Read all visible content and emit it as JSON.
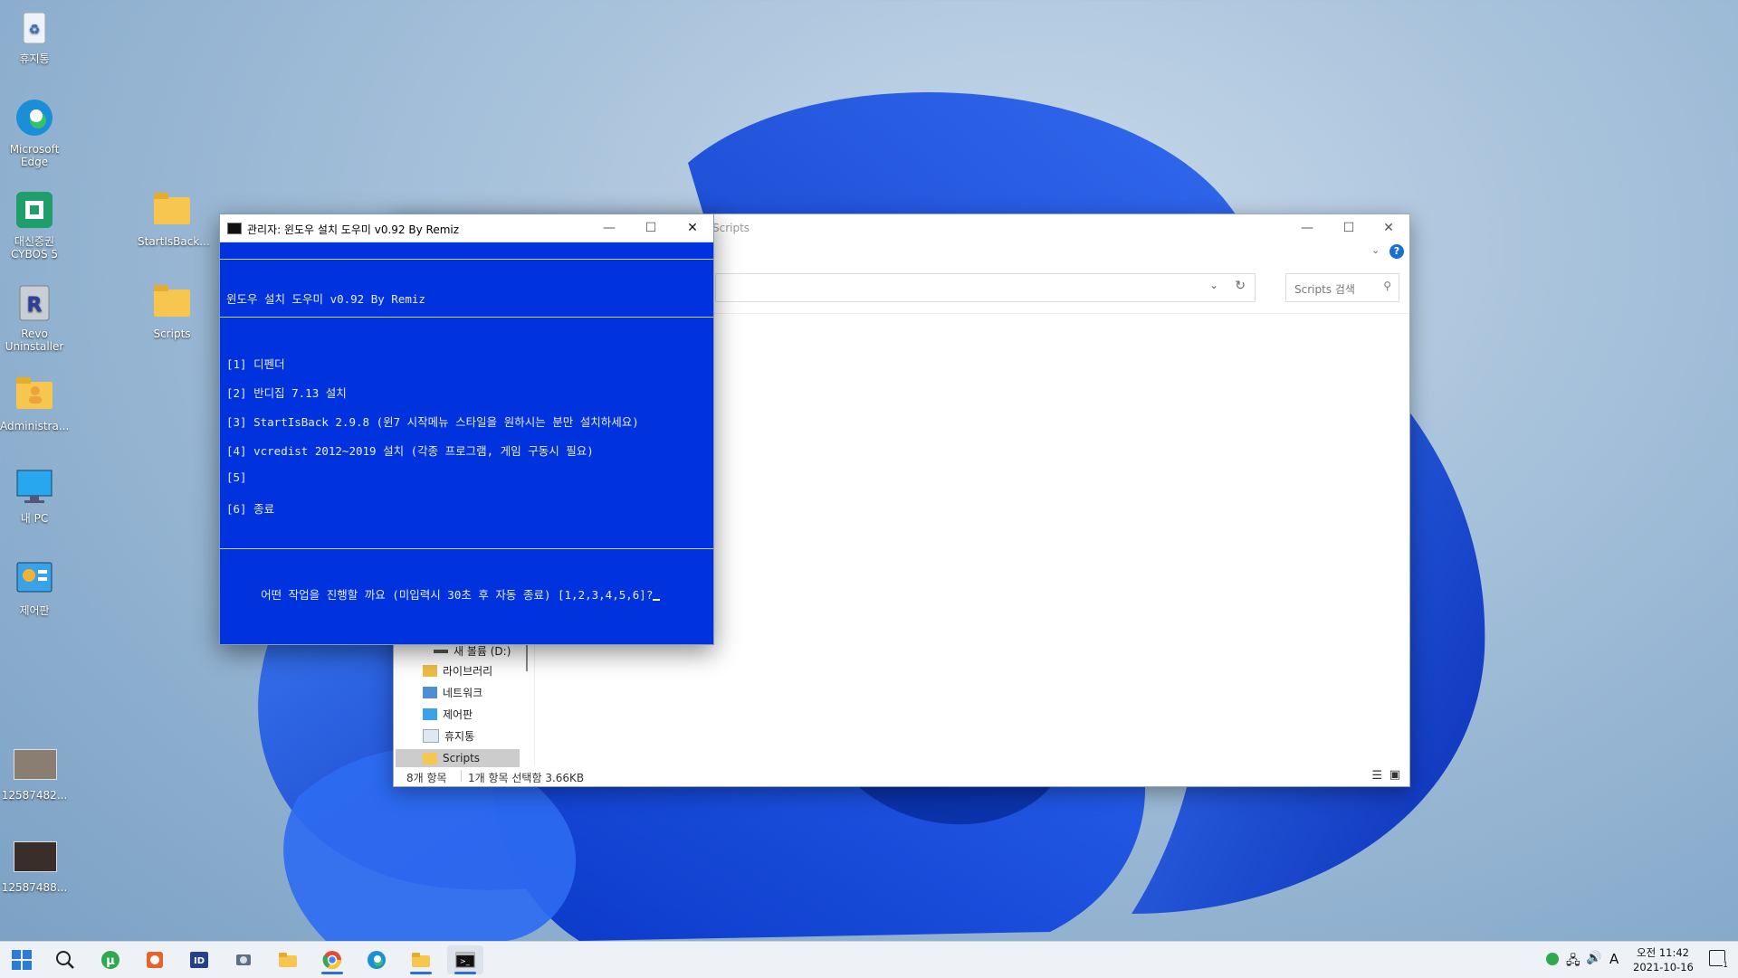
{
  "desktop": {
    "icons": [
      {
        "label": "휴지통"
      },
      {
        "label": "Microsoft Edge"
      },
      {
        "label": "대신증권 CYBOS 5"
      },
      {
        "label": "Revo Uninstaller"
      },
      {
        "label": "Administra..."
      },
      {
        "label": "내 PC"
      },
      {
        "label": "제어판"
      },
      {
        "label": "12587482..."
      },
      {
        "label": "12587488..."
      },
      {
        "label": "StartIsBack..."
      },
      {
        "label": "Scripts"
      }
    ]
  },
  "explorer": {
    "title": "Scripts",
    "search_placeholder": "Scripts 검색",
    "nav": [
      "새 볼륨 (D:)",
      "라이브러리",
      "네트워크",
      "제어판",
      "휴지통",
      "Scripts"
    ],
    "status_count": "8개 항목",
    "status_selection": "1개 항목 선택함 3.66KB"
  },
  "console": {
    "title": "관리자:  윈도우 설치 도우미 v0.92 By Remiz",
    "header": "윈도우 설치 도우미 v0.92 By Remiz",
    "menu": [
      "[1] 디펜더",
      "[2] 반디집 7.13 설치",
      "[3] StartIsBack 2.9.8 (윈7 시작메뉴 스타일을 원하시는 분만 설치하세요)",
      "[4] vcredist 2012~2019 설치 (각종 프로그램, 게임 구동시 필요)",
      "[5]",
      "[6] 종료"
    ],
    "prompt": "어떤 작업을 진행할 까요 (미입력시 30초 후 자동 종료) [1,2,3,4,5,6]?"
  },
  "taskbar": {
    "clock_time": "오전 11:42",
    "clock_date": "2021-10-16",
    "ime": "A",
    "notification_count": "1"
  },
  "colors": {
    "console_bg": "#0032de",
    "accent": "#2b6fd6"
  }
}
